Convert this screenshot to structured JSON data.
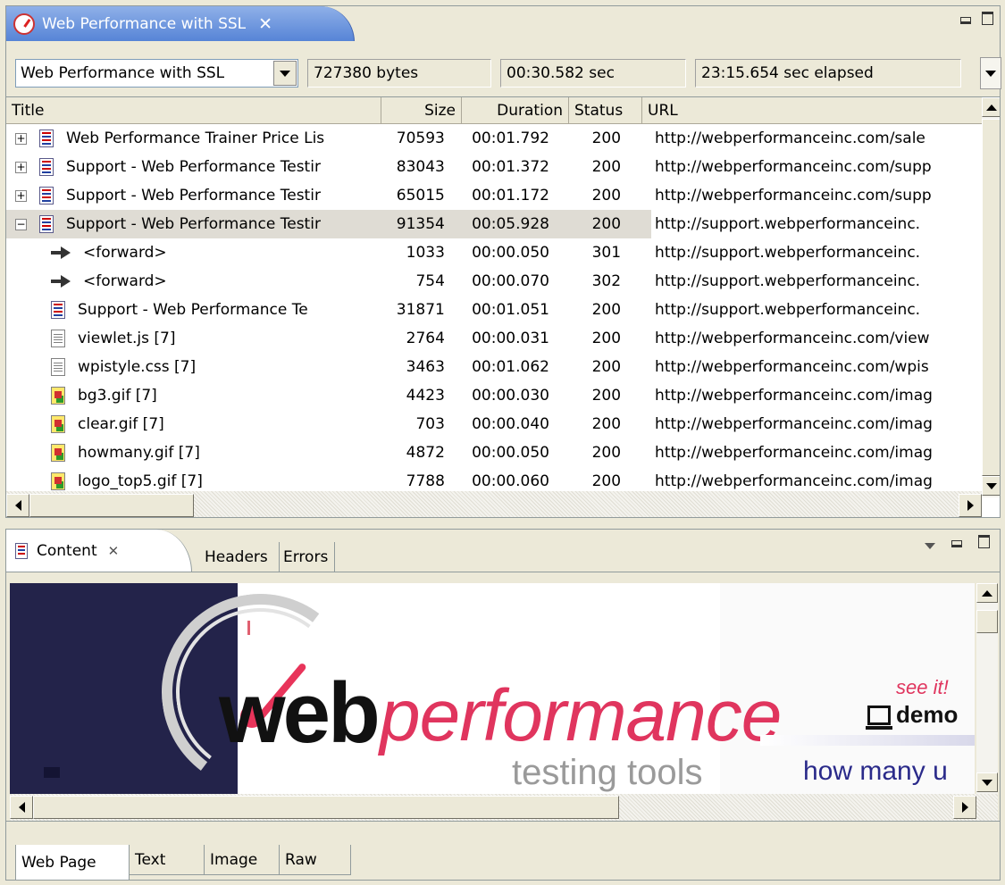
{
  "top_view": {
    "tab_title": "Web Performance with SSL",
    "close_icon": "close-icon"
  },
  "toolbar": {
    "selector_value": "Web Performance with SSL",
    "bytes": "727380 bytes",
    "duration": "00:30.582 sec",
    "elapsed": "23:15.654 sec elapsed"
  },
  "table": {
    "columns": [
      "Title",
      "Size",
      "Duration",
      "Status",
      "URL"
    ],
    "rows": [
      {
        "title": "Web Performance Trainer Price Lis",
        "size": "70593",
        "duration": "00:01.792",
        "status": "200",
        "url": "http://webperformanceinc.com/sale",
        "icon": "page-icon",
        "expander": "+"
      },
      {
        "title": "Support - Web Performance Testir",
        "size": "83043",
        "duration": "00:01.372",
        "status": "200",
        "url": "http://webperformanceinc.com/supp",
        "icon": "page-icon",
        "expander": "+"
      },
      {
        "title": "Support - Web Performance Testir",
        "size": "65015",
        "duration": "00:01.172",
        "status": "200",
        "url": "http://webperformanceinc.com/supp",
        "icon": "page-icon",
        "expander": "+"
      },
      {
        "title": "Support - Web Performance Testir",
        "size": "91354",
        "duration": "00:05.928",
        "status": "200",
        "url": "http://support.webperformanceinc.",
        "icon": "page-icon",
        "expander": "−"
      },
      {
        "title": "<forward>",
        "size": "1033",
        "duration": "00:00.050",
        "status": "301",
        "url": "http://support.webperformanceinc.",
        "icon": "forward-arrow-icon"
      },
      {
        "title": "<forward>",
        "size": "754",
        "duration": "00:00.070",
        "status": "302",
        "url": "http://support.webperformanceinc.",
        "icon": "forward-arrow-icon"
      },
      {
        "title": "Support - Web Performance Te",
        "size": "31871",
        "duration": "00:01.051",
        "status": "200",
        "url": "http://support.webperformanceinc.",
        "icon": "page-icon"
      },
      {
        "title": "viewlet.js [7]",
        "size": "2764",
        "duration": "00:00.031",
        "status": "200",
        "url": "http://webperformanceinc.com/view",
        "icon": "document-icon"
      },
      {
        "title": "wpistyle.css [7]",
        "size": "3463",
        "duration": "00:01.062",
        "status": "200",
        "url": "http://webperformanceinc.com/wpis",
        "icon": "document-icon"
      },
      {
        "title": "bg3.gif [7]",
        "size": "4423",
        "duration": "00:00.030",
        "status": "200",
        "url": "http://webperformanceinc.com/imag",
        "icon": "image-icon"
      },
      {
        "title": "clear.gif [7]",
        "size": "703",
        "duration": "00:00.040",
        "status": "200",
        "url": "http://webperformanceinc.com/imag",
        "icon": "image-icon"
      },
      {
        "title": "howmany.gif [7]",
        "size": "4872",
        "duration": "00:00.050",
        "status": "200",
        "url": "http://webperformanceinc.com/imag",
        "icon": "image-icon"
      },
      {
        "title": "logo_top5.gif [7]",
        "size": "7788",
        "duration": "00:00.060",
        "status": "200",
        "url": "http://webperformanceinc.com/imag",
        "icon": "image-icon"
      }
    ]
  },
  "content_view": {
    "tabs": [
      "Content",
      "Headers",
      "Errors"
    ],
    "page": {
      "logo_web": "web",
      "logo_performance": "performance",
      "logo_sub": "testing tools",
      "see_it": "see it!",
      "demo": "demo",
      "how_many": "how many u"
    },
    "bottom_tabs": [
      "Web Page",
      "Text",
      "Image",
      "Raw"
    ]
  },
  "colors": {
    "tab_blue": "#5583d6",
    "brand_pink": "#e0355e",
    "navy": "#23234a"
  }
}
